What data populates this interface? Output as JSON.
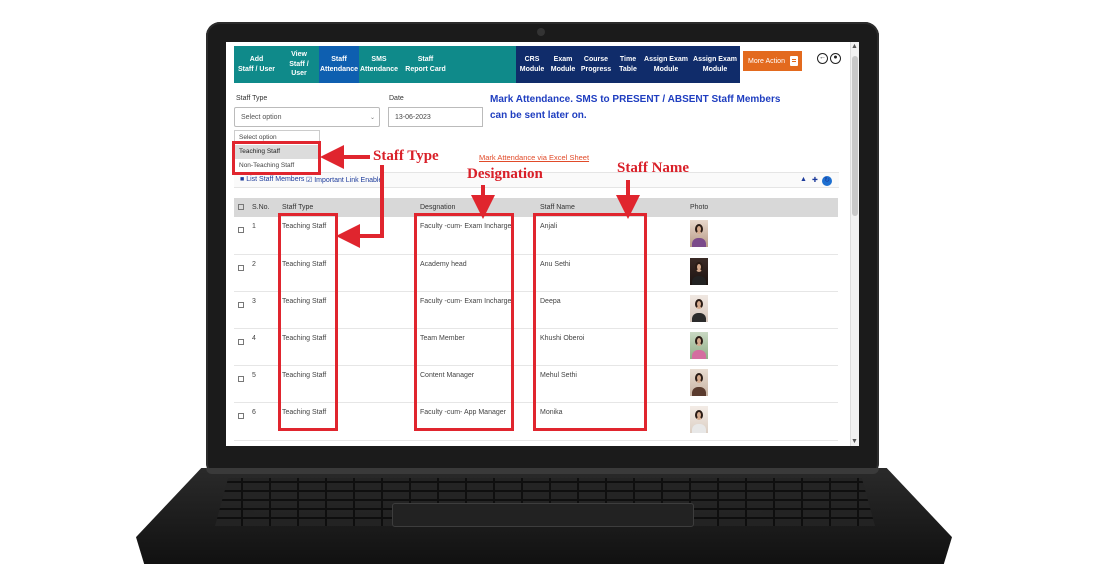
{
  "nav": {
    "left_items": [
      {
        "label": "Add\nStaff / User",
        "color": "teal"
      },
      {
        "label": "View\nStaff / User",
        "color": "teal"
      },
      {
        "label": "Staff\nAttendance",
        "color": "blue"
      },
      {
        "label": "SMS\nAttendance",
        "color": "teal"
      },
      {
        "label": "Staff\nReport Card",
        "color": "teal"
      }
    ],
    "right_items": [
      {
        "label": "CRS\nModule"
      },
      {
        "label": "Exam\nModule"
      },
      {
        "label": "Course\nProgress"
      },
      {
        "label": "Time\nTable"
      },
      {
        "label": "Assign Exam\nModule"
      },
      {
        "label": "Assign Exam\nModule"
      }
    ],
    "more_action": "More Action"
  },
  "form": {
    "staff_type_label": "Staff Type",
    "staff_type_value": "Select option",
    "date_label": "Date",
    "date_value": "13-06-2023",
    "notice": "Mark Attendance. SMS to PRESENT / ABSENT Staff Members can be sent later on.",
    "dropdown_options": [
      "Select option",
      "Teaching Staff",
      "Non-Teaching Staff"
    ],
    "excel_link": "Mark Attendance via Excel Sheet"
  },
  "toolbar": {
    "list_link": "List Staff Members",
    "important_link": "Important Link Enable"
  },
  "table": {
    "headers": [
      "S.No.",
      "Staff Type",
      "Desgnation",
      "Staff Name",
      "Photo"
    ],
    "rows": [
      {
        "sno": "1",
        "type": "Teaching Staff",
        "designation": "Faculty -cum- Exam Incharge",
        "name": "Anjali"
      },
      {
        "sno": "2",
        "type": "Teaching Staff",
        "designation": "Academy head",
        "name": "Anu Sethi"
      },
      {
        "sno": "3",
        "type": "Teaching Staff",
        "designation": "Faculty -cum- Exam Incharge",
        "name": "Deepa"
      },
      {
        "sno": "4",
        "type": "Teaching Staff",
        "designation": "Team Member",
        "name": "Khushi Oberoi"
      },
      {
        "sno": "5",
        "type": "Teaching Staff",
        "designation": "Content Manager",
        "name": "Mehul Sethi"
      },
      {
        "sno": "6",
        "type": "Teaching Staff",
        "designation": "Faculty -cum- App Manager",
        "name": "Monika"
      }
    ]
  },
  "annotations": {
    "staff_type": "Staff Type",
    "designation": "Designation",
    "staff_name": "Staff Name"
  },
  "colors": {
    "teal": "#0f8a8a",
    "active_blue": "#0e5fb0",
    "navy": "#102c6a",
    "orange": "#e36a1e",
    "annotation_red": "#e0252e",
    "notice_blue": "#1f3ec0"
  }
}
